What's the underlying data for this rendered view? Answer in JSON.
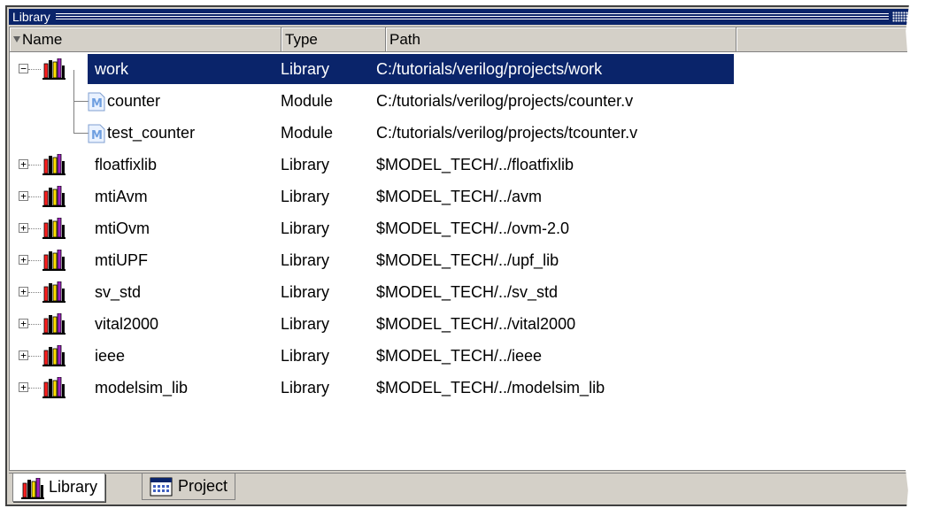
{
  "window": {
    "title": "Library"
  },
  "columns": {
    "name": "Name",
    "type": "Type",
    "path": "Path"
  },
  "rows": [
    {
      "name": "work",
      "type": "Library",
      "path": "C:/tutorials/verilog/projects/work",
      "kind": "library",
      "expanded": true,
      "selected": true
    },
    {
      "name": "counter",
      "type": "Module",
      "path": "C:/tutorials/verilog/projects/counter.v",
      "kind": "module"
    },
    {
      "name": "test_counter",
      "type": "Module",
      "path": "C:/tutorials/verilog/projects/tcounter.v",
      "kind": "module"
    },
    {
      "name": "floatfixlib",
      "type": "Library",
      "path": "$MODEL_TECH/../floatfixlib",
      "kind": "library"
    },
    {
      "name": "mtiAvm",
      "type": "Library",
      "path": "$MODEL_TECH/../avm",
      "kind": "library"
    },
    {
      "name": "mtiOvm",
      "type": "Library",
      "path": "$MODEL_TECH/../ovm-2.0",
      "kind": "library"
    },
    {
      "name": "mtiUPF",
      "type": "Library",
      "path": "$MODEL_TECH/../upf_lib",
      "kind": "library"
    },
    {
      "name": "sv_std",
      "type": "Library",
      "path": "$MODEL_TECH/../sv_std",
      "kind": "library"
    },
    {
      "name": "vital2000",
      "type": "Library",
      "path": "$MODEL_TECH/../vital2000",
      "kind": "library"
    },
    {
      "name": "ieee",
      "type": "Library",
      "path": "$MODEL_TECH/../ieee",
      "kind": "library"
    },
    {
      "name": "modelsim_lib",
      "type": "Library",
      "path": "$MODEL_TECH/../modelsim_lib",
      "kind": "library"
    }
  ],
  "tabs": [
    {
      "label": "Library",
      "icon": "library-icon",
      "active": true
    },
    {
      "label": "Project",
      "icon": "project-icon",
      "active": false
    }
  ],
  "colors": {
    "selection": "#0a246a",
    "panel": "#d4d0c8"
  }
}
